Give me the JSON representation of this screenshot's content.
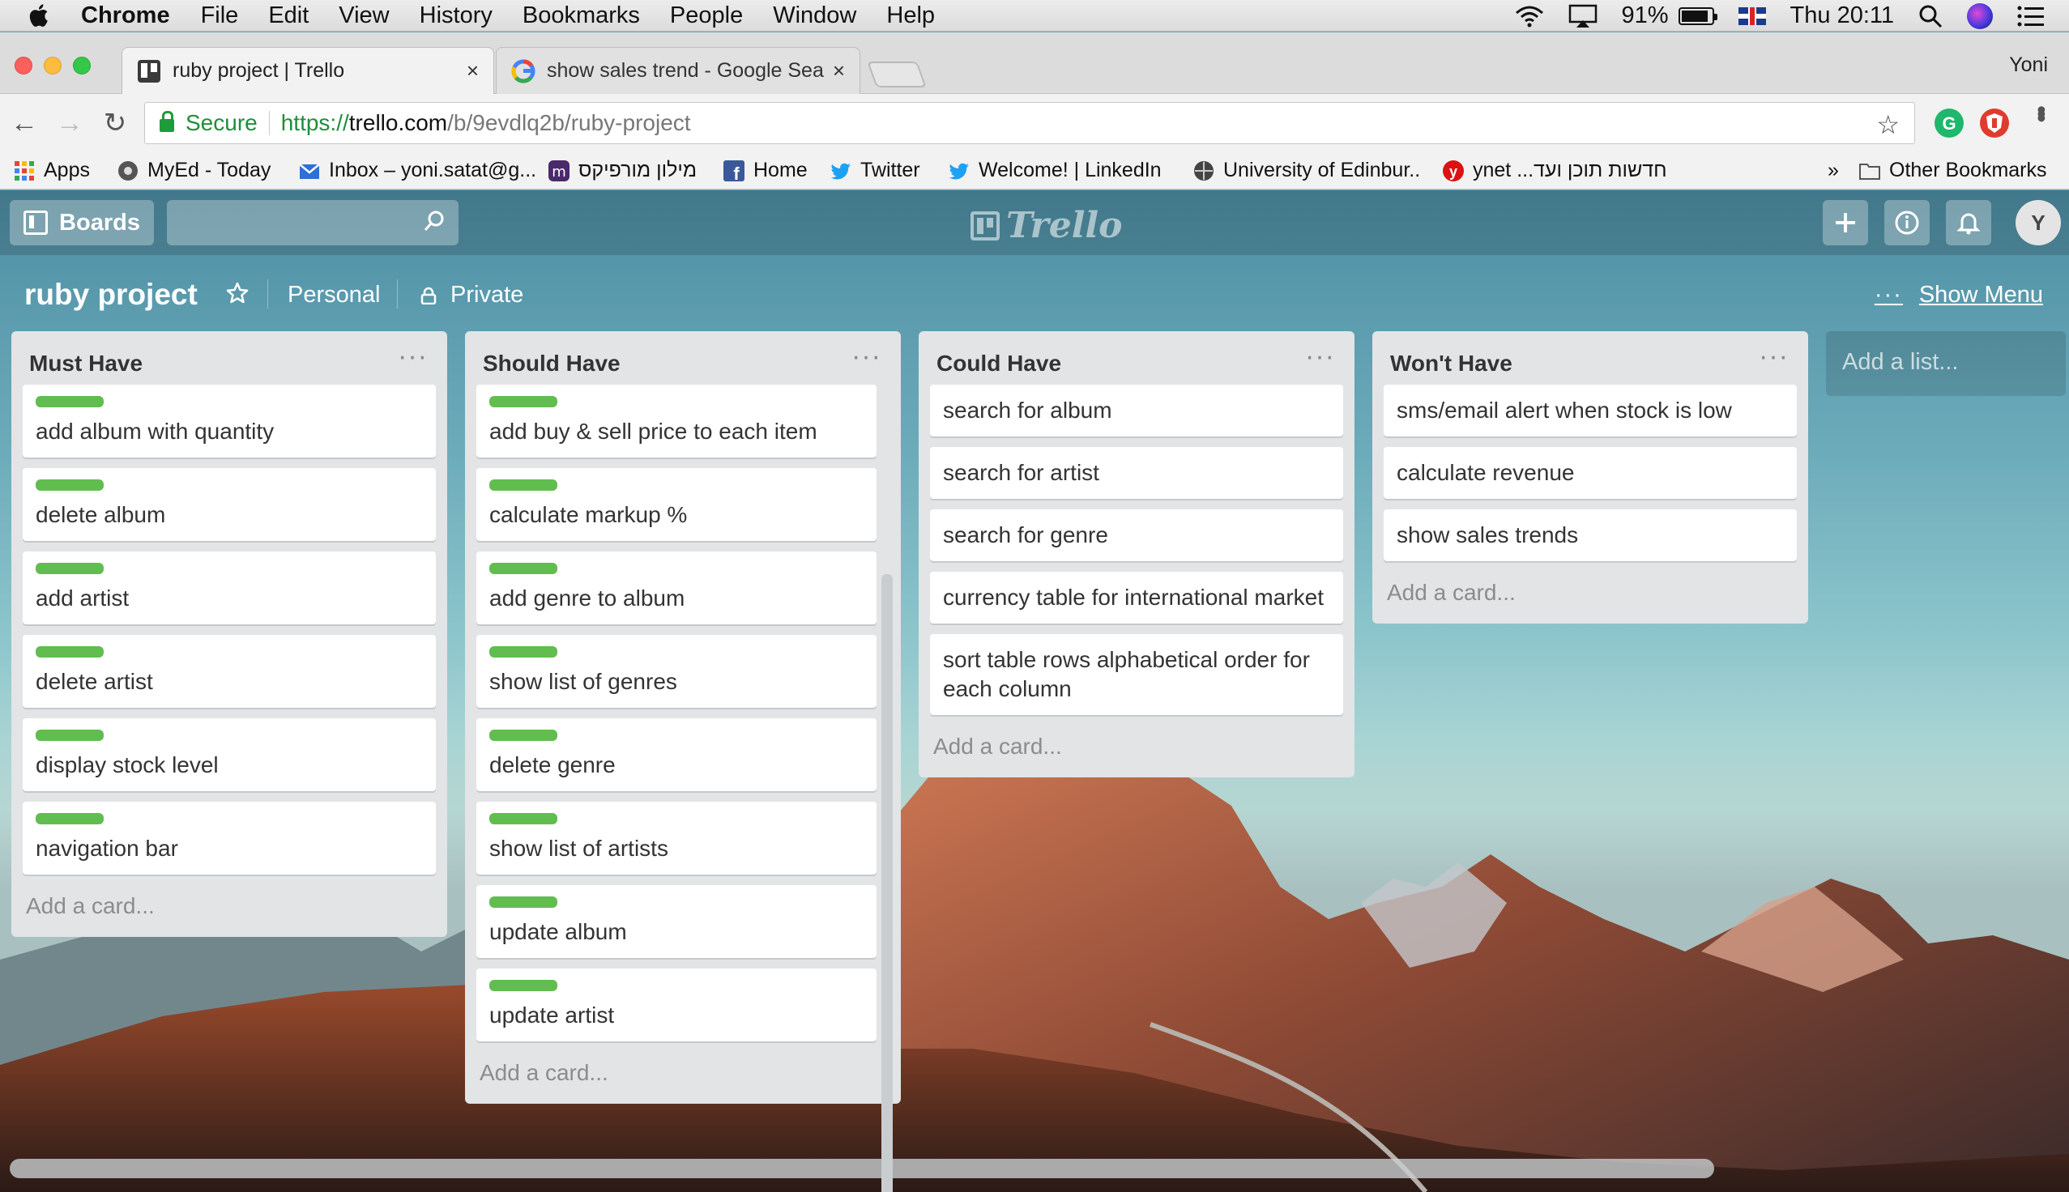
{
  "macos": {
    "app": "Chrome",
    "menu": [
      "File",
      "Edit",
      "View",
      "History",
      "Bookmarks",
      "People",
      "Window",
      "Help"
    ],
    "battery": "91%",
    "battery_level": 0.91,
    "clock": "Thu 20:11"
  },
  "browser": {
    "tabs": [
      {
        "title": "ruby project | Trello",
        "active": true
      },
      {
        "title": "show sales trend - Google Sea",
        "active": false
      }
    ],
    "profile": "Yoni",
    "url": {
      "secure_label": "Secure",
      "scheme": "https://",
      "host": "trello.com",
      "path": "/b/9evdlq2b/ruby-project"
    },
    "bookmarks": [
      {
        "label": "Apps",
        "icon": "apps-grid-icon"
      },
      {
        "label": "MyEd - Today",
        "icon": "myed-icon"
      },
      {
        "label": "Inbox – yoni.satat@g...",
        "icon": "inbox-icon"
      },
      {
        "label": "מילון מורפיקס",
        "icon": "morfix-icon"
      },
      {
        "label": "Home",
        "icon": "facebook-icon"
      },
      {
        "label": "Twitter",
        "icon": "twitter-icon"
      },
      {
        "label": "Welcome! | LinkedIn",
        "icon": "twitter-icon"
      },
      {
        "label": "University of Edinbur..",
        "icon": "edinburgh-icon"
      },
      {
        "label": "ynet ...חדשות תוכן ועד",
        "icon": "ynet-icon"
      }
    ],
    "bookmarks_overflow": "»",
    "other_bookmarks": "Other Bookmarks"
  },
  "trello": {
    "boards_button": "Boards",
    "logo": "Trello",
    "avatar_initial": "Y",
    "board": {
      "title": "ruby project",
      "team": "Personal",
      "visibility": "Private",
      "show_menu": "Show Menu",
      "more": "···"
    },
    "list_menu": "···",
    "label_color": "#61bd4f",
    "lists": [
      {
        "name": "Must Have",
        "add_card": "Add a card...",
        "cards": [
          {
            "text": "add album with quantity",
            "label": true
          },
          {
            "text": "delete album",
            "label": true
          },
          {
            "text": "add artist",
            "label": true
          },
          {
            "text": "delete artist",
            "label": true
          },
          {
            "text": "display stock level",
            "label": true
          },
          {
            "text": "navigation bar",
            "label": true
          }
        ]
      },
      {
        "name": "Should Have",
        "add_card": "Add a card...",
        "cards": [
          {
            "text": "add buy & sell price to each item",
            "label": true
          },
          {
            "text": "calculate markup %",
            "label": true
          },
          {
            "text": "add genre to album",
            "label": true
          },
          {
            "text": "show list of genres",
            "label": true
          },
          {
            "text": "delete genre",
            "label": true
          },
          {
            "text": "show list of artists",
            "label": true
          },
          {
            "text": "update album",
            "label": true
          },
          {
            "text": "update artist",
            "label": true
          }
        ]
      },
      {
        "name": "Could Have",
        "add_card": "Add a card...",
        "cards": [
          {
            "text": "search for album",
            "label": false
          },
          {
            "text": "search for artist",
            "label": false
          },
          {
            "text": "search for genre",
            "label": false
          },
          {
            "text": "currency table for international market",
            "label": false
          },
          {
            "text": "sort table rows alphabetical order for each column",
            "label": false
          }
        ]
      },
      {
        "name": "Won't Have",
        "add_card": "Add a card...",
        "cards": [
          {
            "text": "sms/email alert when stock is low",
            "label": false
          },
          {
            "text": "calculate revenue",
            "label": false
          },
          {
            "text": "show sales trends",
            "label": false
          }
        ]
      }
    ],
    "add_list": "Add a list..."
  }
}
